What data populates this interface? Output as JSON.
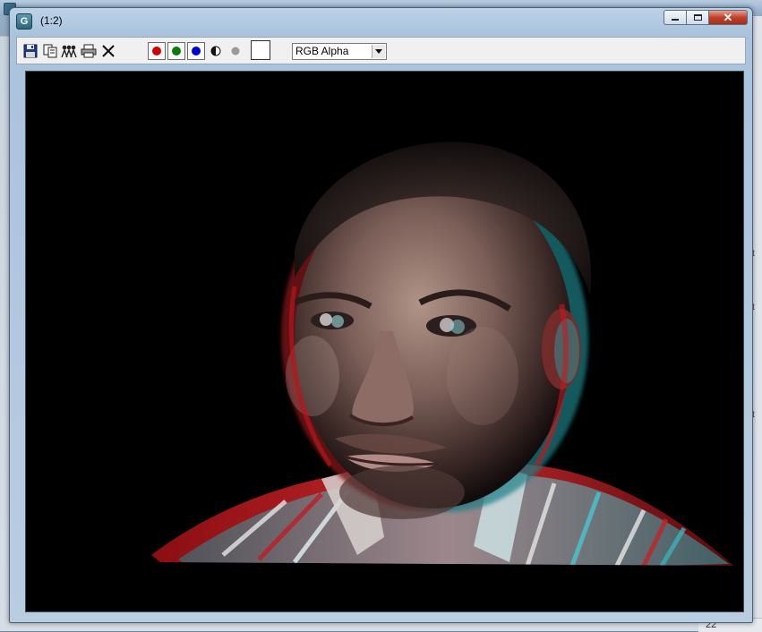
{
  "window": {
    "title": "(1:2)",
    "app_icon": "G",
    "minimize_icon": "minimize-icon",
    "maximize_icon": "maximize-icon",
    "close_icon": "close-icon",
    "close_label": "✕"
  },
  "toolbar": {
    "icons": [
      "save-icon",
      "copy-icon",
      "clone-icon",
      "print-icon",
      "clear-icon"
    ],
    "channels": [
      {
        "name": "red-channel-toggle",
        "color": "#cc0000"
      },
      {
        "name": "green-channel-toggle",
        "color": "#0a7a0a"
      },
      {
        "name": "blue-channel-toggle",
        "color": "#0000cc"
      }
    ],
    "monochrome_icon": "monochrome-icon",
    "alpha_icon": "alpha-icon",
    "swatch_color": "#ffffff",
    "channel_select": {
      "value": "RGB Alpha"
    }
  },
  "render": {
    "description_icon": "anaglyph-render-image",
    "background_color": "#000000"
  },
  "backdrop": {
    "right_marks": [
      "t",
      "t",
      "t",
      "s"
    ],
    "bottom_text": "22"
  }
}
